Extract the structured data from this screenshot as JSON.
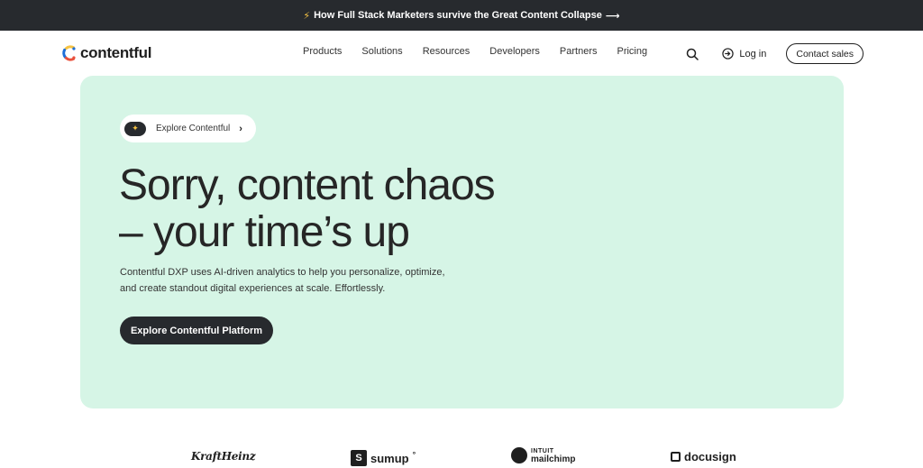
{
  "announcement": {
    "icon": "lightning-bolt-icon",
    "text": "How Full Stack Marketers survive the Great Content Collapse",
    "arrow": "⟶"
  },
  "brand": {
    "logo_text": "contentful",
    "colors": {
      "yellow": "#f6c343",
      "red": "#e9513c",
      "blue": "#1e6fd9",
      "dark": "#272a2e",
      "hero_bg": "#d6f5e6"
    }
  },
  "nav": {
    "links": [
      "Products",
      "Solutions",
      "Resources",
      "Developers",
      "Partners",
      "Pricing"
    ],
    "login": "Log in",
    "contact": "Contact sales"
  },
  "hero": {
    "pill_label": "Explore Contentful",
    "pill_icon": "sparkle-icon",
    "headline_line1": "Sorry, content chaos",
    "headline_line2": "– your time’s up",
    "subtext": "Contentful DXP uses AI-driven analytics to help you personalize, optimize, and create standout digital experiences at scale. Effortlessly.",
    "cta": "Explore Contentful Platform"
  },
  "customer_logos": {
    "kraft": "KraftHeinz",
    "sumup": "sumup",
    "sumup_mark": "°",
    "mailchimp_intuit": "INTUIT",
    "mailchimp_name": "mailchimp",
    "docusign": "docusign"
  }
}
